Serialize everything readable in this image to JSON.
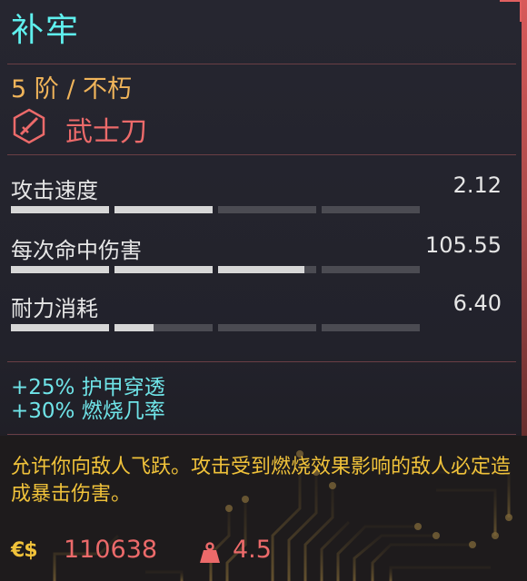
{
  "item": {
    "name": "补牢",
    "tier": "5 阶 / 不朽",
    "weapon_type": "武士刀"
  },
  "stats": [
    {
      "label": "攻击速度",
      "value": "2.12",
      "fill": 0.5
    },
    {
      "label": "每次命中伤害",
      "value": "105.55",
      "fill": 0.72
    },
    {
      "label": "耐力消耗",
      "value": "6.40",
      "fill": 0.35
    }
  ],
  "mods": [
    "+25% 护甲穿透",
    "+30% 燃烧几率"
  ],
  "description": "允许你向敌人飞跃。攻击受到燃烧效果影响的敌人必定造成暴击伤害。",
  "footer": {
    "currency_symbol": "€$",
    "price": "110638",
    "weight": "4.5"
  },
  "colors": {
    "title": "#5ff0ee",
    "tier": "#f0b45a",
    "type": "#ec6a6a",
    "mods": "#6fe4e8",
    "description": "#f0c23a"
  },
  "icons": {
    "weapon_type": "katana-hex-icon",
    "currency": "eddies-icon",
    "weight": "weight-icon"
  }
}
